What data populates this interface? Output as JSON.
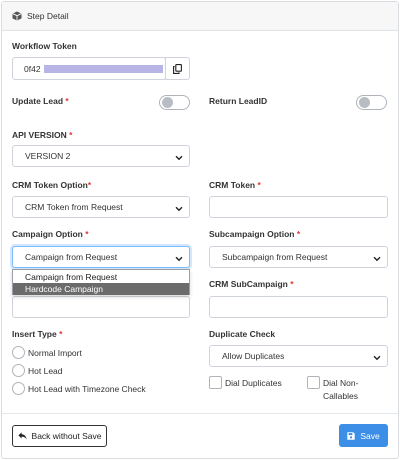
{
  "header": {
    "title": "Step Detail",
    "icon": "cube-icon"
  },
  "workflow_token": {
    "label": "Workflow Token",
    "value_prefix": "0f42",
    "redacted": true,
    "copy_icon": "copy-icon"
  },
  "update_lead": {
    "label": "Update Lead",
    "required": "*",
    "enabled": false
  },
  "return_leadid": {
    "label": "Return LeadID",
    "enabled": false
  },
  "api_version": {
    "label": "API VERSION",
    "required": "*",
    "value": "VERSION 2"
  },
  "crm_token_option": {
    "label": "CRM Token Option",
    "required": "*",
    "value": "CRM Token from Request"
  },
  "crm_token": {
    "label": "CRM Token",
    "required": "*",
    "value": ""
  },
  "campaign_option": {
    "label": "Campaign Option",
    "required": "*",
    "value": "Campaign from Request",
    "dropdown_open": true,
    "options": [
      "Campaign from Request",
      "Hardcode Campaign"
    ],
    "highlighted": "Hardcode Campaign"
  },
  "subcampaign_option": {
    "label": "Subcampaign Option",
    "required": "*",
    "value": "Subcampaign from Request"
  },
  "crm_subcampaign": {
    "label": "CRM SubCampaign",
    "required": "*",
    "value": ""
  },
  "insert_type": {
    "label": "Insert Type",
    "required": "*",
    "options": [
      "Normal Import",
      "Hot Lead",
      "Hot Lead with Timezone Check"
    ]
  },
  "duplicate_check": {
    "label": "Duplicate Check",
    "value": "Allow Duplicates",
    "checkbox_1": "Dial Duplicates",
    "checkbox_2_line1": "Dial Non-",
    "checkbox_2_line2": "Callables"
  },
  "footer": {
    "back_label": "Back without Save",
    "back_icon": "reply-arrow-icon",
    "save_label": "Save",
    "save_icon": "floppy-disk-icon"
  },
  "colors": {
    "primary": "#3d8ee6",
    "required": "#e3342f",
    "redaction": "#b9b4e6",
    "dropdown_highlight": "#6b6b6b"
  }
}
